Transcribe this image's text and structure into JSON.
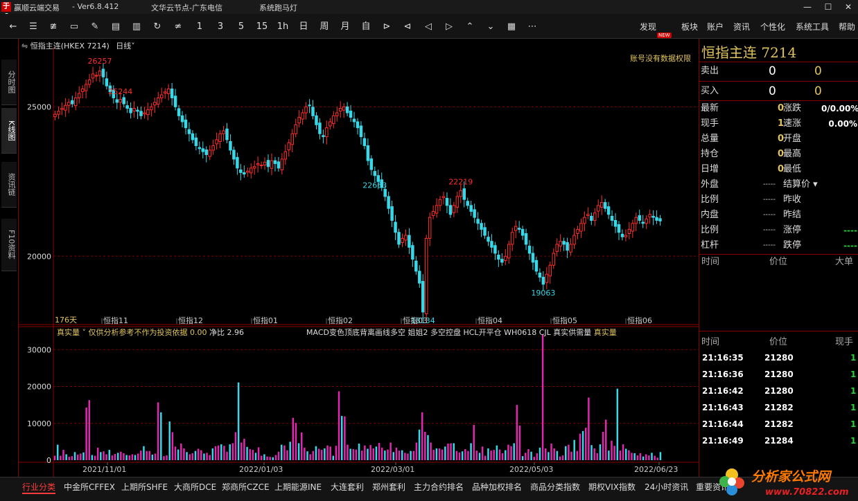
{
  "titlebar": {
    "logo": "于6",
    "app": "赢顺云端交易",
    "version": "- Ver6.8.412",
    "server": "文华云节点-广东电信",
    "func": "系统跑马灯",
    "min": "—",
    "max": "☐",
    "close": "✕"
  },
  "toolbar": {
    "periods": [
      "1",
      "3",
      "5",
      "15",
      "1h",
      "日",
      "周",
      "月"
    ],
    "menus": [
      "发现",
      "板块",
      "账户",
      "资讯",
      "个性化",
      "系统工具",
      "帮助"
    ],
    "new_badge": "NEW",
    "more": "⋯"
  },
  "sidetabs": [
    "分时图",
    "K线图",
    "资讯链",
    "F10资料"
  ],
  "chart": {
    "symbol": "恒指主连(HKEX 7214)",
    "period": "日线",
    "permission": "账号没有数据权限",
    "days": "176天",
    "ind_label": "真实量",
    "ind_text": "仅供分析参考不作为投资依据",
    "ind_val": "0.00",
    "ind_net": "净比 2.96",
    "ind_items": [
      "MACD变色顶底背离画线多空",
      "姐姐2",
      "多空控盘",
      "HCL开平仓",
      "WH0618",
      "CJL",
      "真实供需量",
      "真实量"
    ],
    "month_labels": [
      "恒指11",
      "恒指12",
      "恒指01",
      "恒指02",
      "恒指03",
      "恒指04",
      "恒指05",
      "恒指06"
    ],
    "date_labels": [
      "2021/11/01",
      "2022/01/03",
      "2022/03/01",
      "2022/05/03",
      "2022/06/23"
    ]
  },
  "chart_data": [
    {
      "type": "candlestick",
      "price_axis": [
        "25000",
        "20000"
      ],
      "ylim": [
        17900,
        27000
      ],
      "annotations": [
        {
          "label": "26257",
          "value": 26257
        },
        {
          "label": "25244",
          "value": 25244
        },
        {
          "label": "22663",
          "value": 22663
        },
        {
          "label": "18134",
          "value": 18134
        },
        {
          "label": "22219",
          "value": 22219
        },
        {
          "label": "19063",
          "value": 19063
        }
      ],
      "close": [
        24750,
        24850,
        24950,
        25050,
        25150,
        25100,
        25300,
        25450,
        25600,
        25750,
        25900,
        26100,
        26050,
        26200,
        26000,
        25700,
        25500,
        25300,
        25150,
        25250,
        25100,
        24950,
        24800,
        24950,
        24850,
        24700,
        24800,
        24900,
        25000,
        25150,
        25300,
        25400,
        25500,
        25600,
        25300,
        25000,
        24700,
        24500,
        24300,
        24100,
        23900,
        23700,
        23600,
        23500,
        23400,
        23550,
        23700,
        23900,
        24100,
        24200,
        23900,
        23550,
        23250,
        22950,
        22800,
        22750,
        22850,
        22950,
        23000,
        23100,
        23050,
        23150,
        23000,
        23200,
        23100,
        22950,
        23250,
        23500,
        23800,
        24100,
        24400,
        24650,
        24800,
        25000,
        25050,
        24700,
        24400,
        24100,
        24000,
        24300,
        24500,
        24700,
        24800,
        24950,
        25000,
        24800,
        24650,
        24500,
        24300,
        24000,
        23700,
        23200,
        22900,
        22700,
        22500,
        22300,
        22000,
        21600,
        21200,
        20800,
        20400,
        20600,
        20700,
        20300,
        19900,
        19500,
        19100,
        18134,
        20600,
        21300,
        21500,
        21700,
        21900,
        22000,
        21700,
        21400,
        21700,
        22000,
        22200,
        21900,
        21700,
        21500,
        21300,
        21100,
        20900,
        20700,
        20500,
        20300,
        20100,
        19900,
        19800,
        20000,
        20400,
        20800,
        21000,
        20900,
        20700,
        20400,
        20100,
        19800,
        19500,
        19300,
        19063,
        19400,
        19700,
        20100,
        20400,
        20500,
        20400,
        20200,
        20400,
        20700,
        20900,
        21100,
        21300,
        21400,
        21200,
        21450,
        21700,
        21800,
        21600,
        21400,
        21200,
        21000,
        20800,
        20650,
        20700,
        20900,
        21100,
        21300,
        21200,
        21100,
        21250,
        21400,
        21300,
        21200,
        21180
      ]
    },
    {
      "type": "bar",
      "ylabel_ticks": [
        "30000",
        "20000",
        "10000",
        "0"
      ],
      "ylim": [
        0,
        34000
      ],
      "values": [
        1200,
        4200,
        1200,
        2800,
        1600,
        900,
        1100,
        2200,
        1500,
        1800,
        2100,
        14300,
        16300,
        1400,
        1200,
        3400,
        2200,
        2400,
        1600,
        2800,
        1300,
        1700,
        2000,
        2300,
        1900,
        1400,
        1300,
        1600,
        1400,
        1800,
        2600,
        3800,
        2500,
        2500,
        1500,
        1800,
        15700,
        13000,
        1100,
        1300,
        10500,
        7600,
        3700,
        2900,
        4500,
        3200,
        2200,
        1600,
        1900,
        2500,
        3100,
        2700,
        1800,
        2000,
        1400,
        3200,
        3800,
        4000,
        4300,
        3900,
        2300,
        4300,
        4600,
        7600,
        21100,
        4800,
        5800,
        3600,
        3000,
        2800,
        2000,
        3500,
        1200,
        1600,
        1000,
        900,
        800,
        1400,
        2300,
        4200,
        4000,
        2700,
        5000,
        11500,
        10100,
        4600,
        7500,
        3400,
        2400,
        1600,
        2500,
        3800,
        3100,
        2800,
        3200,
        4000,
        3700,
        1200,
        3900,
        18700,
        12000,
        11900,
        4200,
        3100,
        3000,
        2900,
        4500,
        2600,
        4000,
        3100,
        4100,
        3200,
        3700,
        4700,
        3400,
        2600,
        2900,
        4800,
        2200,
        3400,
        2600,
        2700,
        2000,
        1800,
        2500,
        2500,
        4800,
        8300,
        13000,
        7700,
        6800,
        4800,
        2800,
        3200,
        3200,
        2900,
        3700,
        4500,
        4600,
        4600,
        2500,
        2100,
        2400,
        3000,
        2500,
        4600,
        9600,
        2600,
        2000,
        3700,
        1200,
        3200,
        2600,
        2800,
        4000,
        2900,
        1900,
        2700,
        4200,
        3800,
        4600,
        15000,
        9400,
        1100,
        2000,
        3000,
        2300,
        900,
        1900,
        3400,
        34000,
        3200,
        2200,
        4500,
        3200,
        2500,
        1000,
        1300,
        3800,
        4200,
        2300,
        5500,
        2500,
        7200,
        7900,
        8800,
        17000,
        4100,
        3200,
        1900,
        4300,
        7700,
        11000,
        2600,
        5300,
        3900,
        19400,
        2600,
        4300,
        3100,
        2700,
        2000,
        1900,
        1300,
        1900,
        1000,
        1600,
        1300,
        2000,
        1200,
        700,
        2200
      ]
    }
  ],
  "quote": {
    "name": "恒指主连",
    "code": "7214",
    "ask_label": "卖出",
    "ask": [
      "0",
      "0"
    ],
    "bid_label": "买入",
    "bid": [
      "0",
      "0"
    ],
    "left": [
      {
        "l": "最新",
        "v": "0"
      },
      {
        "l": "现手",
        "v": "1"
      },
      {
        "l": "总量",
        "v": "0"
      },
      {
        "l": "持仓",
        "v": "0"
      },
      {
        "l": "日增",
        "v": "0"
      },
      {
        "l": "外盘",
        "v": "-----"
      },
      {
        "l": "比例",
        "v": "-----"
      },
      {
        "l": "内盘",
        "v": "-----"
      },
      {
        "l": "比例",
        "v": "-----"
      },
      {
        "l": "杠杆",
        "v": "-----"
      }
    ],
    "right": [
      {
        "l": "涨跌",
        "v": "0/0.00%"
      },
      {
        "l": "速涨",
        "v": "0.00%"
      },
      {
        "l": "开盘",
        "v": ""
      },
      {
        "l": "最高",
        "v": ""
      },
      {
        "l": "最低",
        "v": ""
      },
      {
        "l": "结算价",
        "v": ""
      },
      {
        "l": "昨收",
        "v": ""
      },
      {
        "l": "昨结",
        "v": ""
      },
      {
        "l": "涨停",
        "v": "----"
      },
      {
        "l": "跌停",
        "v": "----"
      }
    ]
  },
  "ticks_header": [
    "时间",
    "价位",
    "大单"
  ],
  "trades_header": [
    "时间",
    "价位",
    "现手"
  ],
  "trades": [
    {
      "t": "21:16:35",
      "p": "21280",
      "q": "1"
    },
    {
      "t": "21:16:36",
      "p": "21280",
      "q": "1"
    },
    {
      "t": "21:16:42",
      "p": "21280",
      "q": "1"
    },
    {
      "t": "21:16:43",
      "p": "21282",
      "q": "1"
    },
    {
      "t": "21:16:44",
      "p": "21282",
      "q": "1"
    },
    {
      "t": "21:16:49",
      "p": "21284",
      "q": "1"
    }
  ],
  "bottom_tabs": [
    "行业分类",
    "中金所CFFEX",
    "上期所SHFE",
    "大商所DCE",
    "郑商所CZCE",
    "上期能源INE",
    "大连套利",
    "郑州套利",
    "主力合约排名",
    "品种加权排名",
    "商品分类指数",
    "期权VIX指数",
    "24小时资讯",
    "重要资讯"
  ],
  "watermark": {
    "text": "分析家公式网",
    "url": "www.70822.com"
  },
  "colors": {
    "up": "#ff2e2e",
    "down": "#38d8e8",
    "volume_up": "#e028b0",
    "accent": "#e0c460",
    "grid": "#8a0000"
  }
}
